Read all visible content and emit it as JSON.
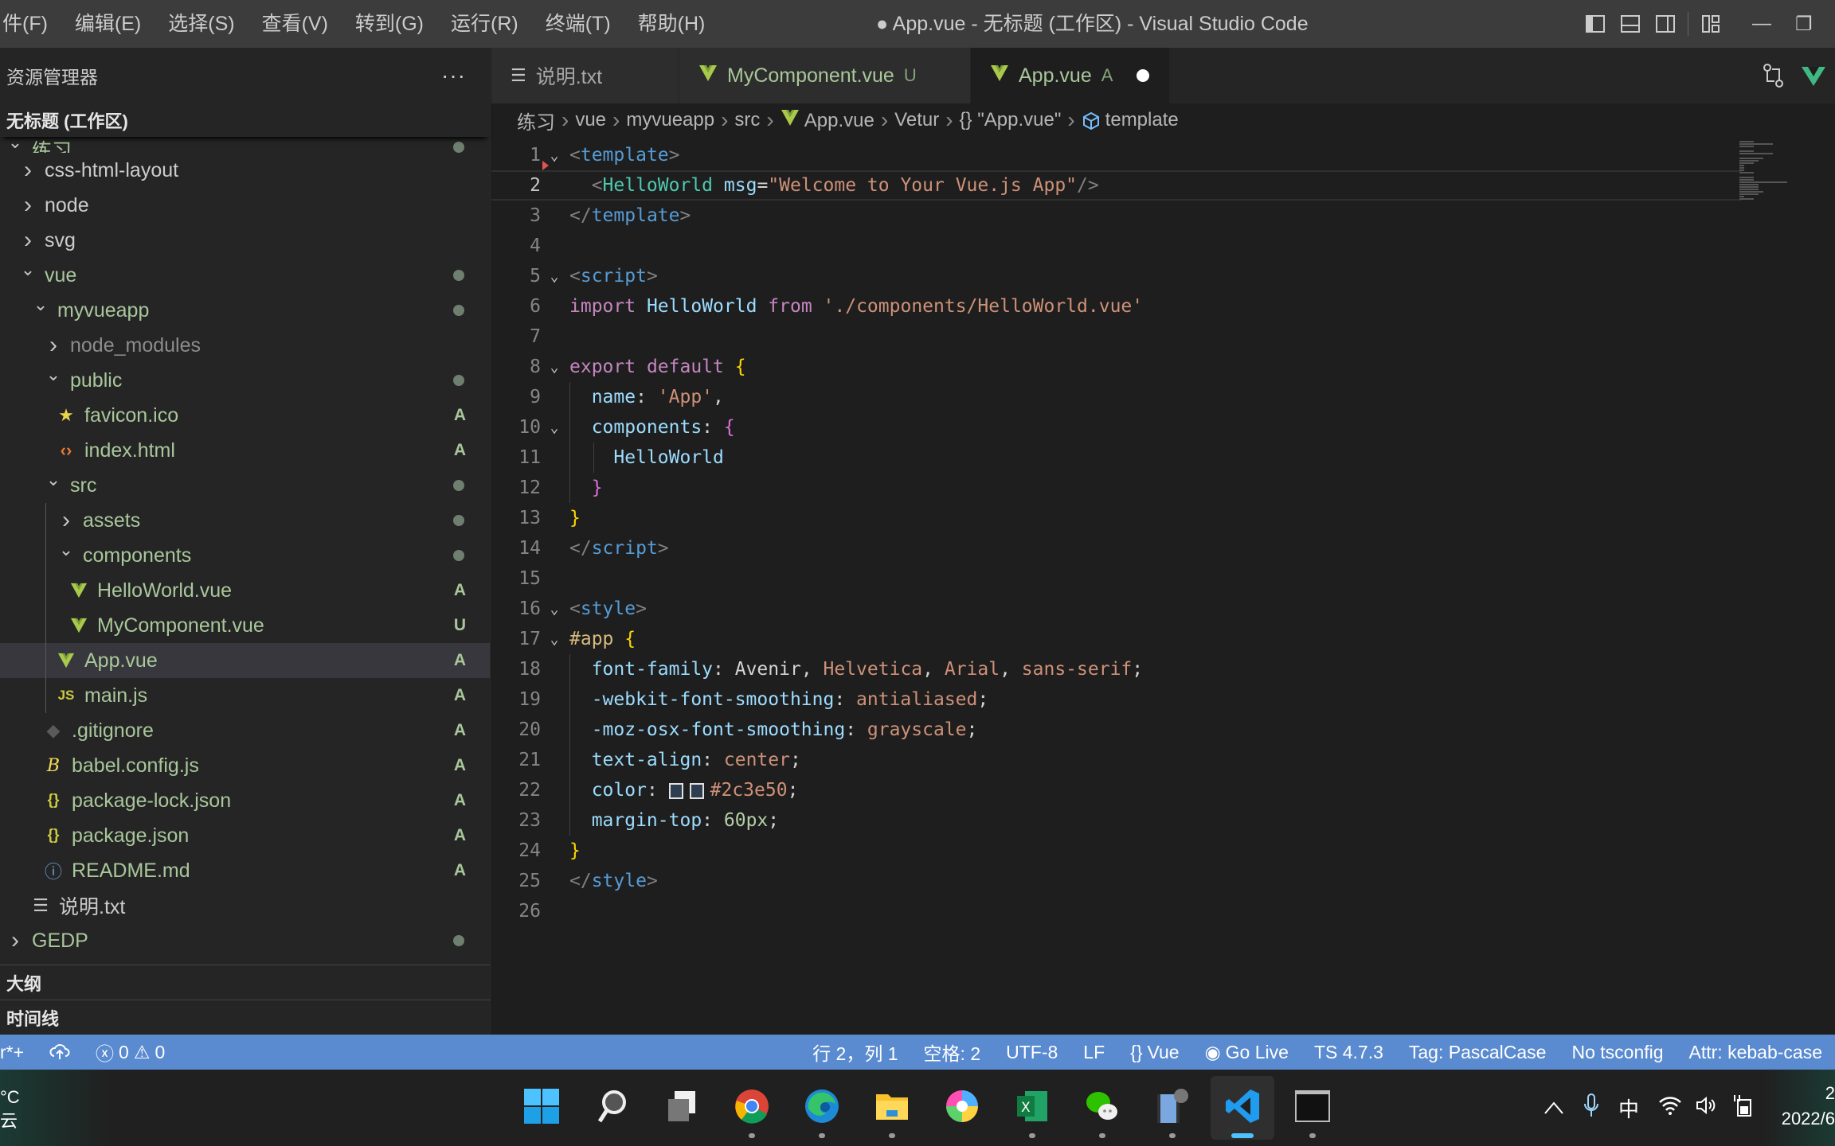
{
  "titlebar": {
    "menu": [
      "件(F)",
      "编辑(E)",
      "选择(S)",
      "查看(V)",
      "转到(G)",
      "运行(R)",
      "终端(T)",
      "帮助(H)"
    ],
    "window_title": "● App.vue - 无标题 (工作区) - Visual Studio Code",
    "minimize": "—",
    "maximize": "❐"
  },
  "sidebar": {
    "title": "资源管理器",
    "more": "···",
    "workspace": "无标题 (工作区)",
    "items": [
      {
        "label": "练习",
        "chevron": "down",
        "git": "mod",
        "status": "dot"
      },
      {
        "label": "css-html-layout",
        "chevron": "right",
        "git": "",
        "status": ""
      },
      {
        "label": "node",
        "chevron": "right",
        "git": "",
        "status": ""
      },
      {
        "label": "svg",
        "chevron": "right",
        "git": "",
        "status": ""
      },
      {
        "label": "vue",
        "chevron": "down",
        "git": "mod",
        "status": "dot"
      },
      {
        "label": "myvueapp",
        "chevron": "down",
        "git": "mod",
        "status": "dot"
      },
      {
        "label": "node_modules",
        "chevron": "right",
        "git": "ignored",
        "status": ""
      },
      {
        "label": "public",
        "chevron": "down",
        "git": "mod",
        "status": "dot"
      },
      {
        "label": "favicon.ico",
        "icon": "star",
        "git": "a",
        "status": "A"
      },
      {
        "label": "index.html",
        "icon": "html",
        "git": "a",
        "status": "A"
      },
      {
        "label": "src",
        "chevron": "down",
        "git": "mod",
        "status": "dot"
      },
      {
        "label": "assets",
        "chevron": "right",
        "git": "mod",
        "status": "dot"
      },
      {
        "label": "components",
        "chevron": "down",
        "git": "mod",
        "status": "dot"
      },
      {
        "label": "HelloWorld.vue",
        "icon": "vue",
        "git": "a",
        "status": "A"
      },
      {
        "label": "MyComponent.vue",
        "icon": "vue",
        "git": "u",
        "status": "U"
      },
      {
        "label": "App.vue",
        "icon": "vue",
        "git": "a",
        "status": "A",
        "selected": true
      },
      {
        "label": "main.js",
        "icon": "js",
        "git": "a",
        "status": "A"
      },
      {
        "label": ".gitignore",
        "icon": "git",
        "git": "a",
        "status": "A"
      },
      {
        "label": "babel.config.js",
        "icon": "babel",
        "git": "a",
        "status": "A"
      },
      {
        "label": "package-lock.json",
        "icon": "json",
        "git": "a",
        "status": "A"
      },
      {
        "label": "package.json",
        "icon": "json",
        "git": "a",
        "status": "A"
      },
      {
        "label": "README.md",
        "icon": "info",
        "git": "a",
        "status": "A"
      },
      {
        "label": "说明.txt",
        "icon": "text",
        "git": "",
        "status": ""
      },
      {
        "label": "GEDP",
        "chevron": "right",
        "git": "mod",
        "status": "dot"
      }
    ],
    "outline": "大纲",
    "timeline": "时间线"
  },
  "tabs": [
    {
      "label": "说明.txt",
      "icon": "text",
      "badge": "",
      "active": false
    },
    {
      "label": "MyComponent.vue",
      "icon": "vue",
      "badge": "U",
      "active": false
    },
    {
      "label": "App.vue",
      "icon": "vue",
      "badge": "A",
      "active": true,
      "dirty": true
    }
  ],
  "breadcrumb": [
    "练习",
    "vue",
    "myvueapp",
    "src",
    "App.vue",
    "Vetur",
    "{} \"App.vue\"",
    "template"
  ],
  "editor": {
    "current_line": 2,
    "lines": [
      [
        {
          "t": "<",
          "c": "c-punc"
        },
        {
          "t": "template",
          "c": "c-tag"
        },
        {
          "t": ">",
          "c": "c-punc"
        }
      ],
      [
        {
          "t": "  <",
          "c": "c-punc"
        },
        {
          "t": "HelloWorld",
          "c": "c-comp"
        },
        {
          "t": " ",
          "c": "c-plain"
        },
        {
          "t": "msg",
          "c": "c-attr"
        },
        {
          "t": "=",
          "c": "c-plain"
        },
        {
          "t": "\"Welcome to Your Vue.js App\"",
          "c": "c-str"
        },
        {
          "t": "/>",
          "c": "c-punc"
        }
      ],
      [
        {
          "t": "</",
          "c": "c-punc"
        },
        {
          "t": "template",
          "c": "c-tag"
        },
        {
          "t": ">",
          "c": "c-punc"
        }
      ],
      [],
      [
        {
          "t": "<",
          "c": "c-punc"
        },
        {
          "t": "script",
          "c": "c-tag"
        },
        {
          "t": ">",
          "c": "c-punc"
        }
      ],
      [
        {
          "t": "import",
          "c": "c-kw"
        },
        {
          "t": " ",
          "c": "c-plain"
        },
        {
          "t": "HelloWorld",
          "c": "c-id"
        },
        {
          "t": " ",
          "c": "c-plain"
        },
        {
          "t": "from",
          "c": "c-kw"
        },
        {
          "t": " ",
          "c": "c-plain"
        },
        {
          "t": "'./components/HelloWorld.vue'",
          "c": "c-str"
        }
      ],
      [],
      [
        {
          "t": "export",
          "c": "c-kw"
        },
        {
          "t": " ",
          "c": "c-plain"
        },
        {
          "t": "default",
          "c": "c-kw"
        },
        {
          "t": " ",
          "c": "c-plain"
        },
        {
          "t": "{",
          "c": "c-brace1"
        }
      ],
      [
        {
          "t": "  name",
          "c": "c-id"
        },
        {
          "t": ": ",
          "c": "c-plain"
        },
        {
          "t": "'App'",
          "c": "c-str"
        },
        {
          "t": ",",
          "c": "c-plain"
        }
      ],
      [
        {
          "t": "  components",
          "c": "c-id"
        },
        {
          "t": ": ",
          "c": "c-plain"
        },
        {
          "t": "{",
          "c": "c-brace2"
        }
      ],
      [
        {
          "t": "    HelloWorld",
          "c": "c-id"
        }
      ],
      [
        {
          "t": "  }",
          "c": "c-brace2"
        }
      ],
      [
        {
          "t": "}",
          "c": "c-brace1"
        }
      ],
      [
        {
          "t": "</",
          "c": "c-punc"
        },
        {
          "t": "script",
          "c": "c-tag"
        },
        {
          "t": ">",
          "c": "c-punc"
        }
      ],
      [],
      [
        {
          "t": "<",
          "c": "c-punc"
        },
        {
          "t": "style",
          "c": "c-tag"
        },
        {
          "t": ">",
          "c": "c-punc"
        }
      ],
      [
        {
          "t": "#app",
          "c": "c-sel"
        },
        {
          "t": " ",
          "c": "c-plain"
        },
        {
          "t": "{",
          "c": "c-brace1"
        }
      ],
      [
        {
          "t": "  font-family",
          "c": "c-prop"
        },
        {
          "t": ": ",
          "c": "c-plain"
        },
        {
          "t": "Avenir",
          "c": "c-plain"
        },
        {
          "t": ", ",
          "c": "c-plain"
        },
        {
          "t": "Helvetica",
          "c": "c-str"
        },
        {
          "t": ", ",
          "c": "c-plain"
        },
        {
          "t": "Arial",
          "c": "c-str"
        },
        {
          "t": ", ",
          "c": "c-plain"
        },
        {
          "t": "sans-serif",
          "c": "c-str"
        },
        {
          "t": ";",
          "c": "c-plain"
        }
      ],
      [
        {
          "t": "  -webkit-font-smoothing",
          "c": "c-prop"
        },
        {
          "t": ": ",
          "c": "c-plain"
        },
        {
          "t": "antialiased",
          "c": "c-str"
        },
        {
          "t": ";",
          "c": "c-plain"
        }
      ],
      [
        {
          "t": "  -moz-osx-font-smoothing",
          "c": "c-prop"
        },
        {
          "t": ": ",
          "c": "c-plain"
        },
        {
          "t": "grayscale",
          "c": "c-str"
        },
        {
          "t": ";",
          "c": "c-plain"
        }
      ],
      [
        {
          "t": "  text-align",
          "c": "c-prop"
        },
        {
          "t": ": ",
          "c": "c-plain"
        },
        {
          "t": "center",
          "c": "c-str"
        },
        {
          "t": ";",
          "c": "c-plain"
        }
      ],
      [
        {
          "t": "  color",
          "c": "c-prop"
        },
        {
          "t": ": ",
          "c": "c-plain"
        },
        {
          "t": "SWATCH",
          "c": "swatch2"
        },
        {
          "t": "#2c3e50",
          "c": "c-str"
        },
        {
          "t": ";",
          "c": "c-plain"
        }
      ],
      [
        {
          "t": "  margin-top",
          "c": "c-prop"
        },
        {
          "t": ": ",
          "c": "c-plain"
        },
        {
          "t": "60px",
          "c": "c-num"
        },
        {
          "t": ";",
          "c": "c-plain"
        }
      ],
      [
        {
          "t": "}",
          "c": "c-brace1"
        }
      ],
      [
        {
          "t": "</",
          "c": "c-punc"
        },
        {
          "t": "style",
          "c": "c-tag"
        },
        {
          "t": ">",
          "c": "c-punc"
        }
      ],
      []
    ],
    "folds": [
      1,
      5,
      8,
      10,
      16,
      17
    ],
    "swatch_color": "#2c3e50"
  },
  "statusbar": {
    "left": {
      "branch": "r*+",
      "sync_icon": "cloud-sync",
      "errors": "0",
      "warnings": "0"
    },
    "right": [
      "行 2，列 1",
      "空格: 2",
      "UTF-8",
      "LF",
      "Vue",
      "Go Live",
      "TS 4.7.3",
      "Tag: PascalCase",
      "No tsconfig",
      "Attr: kebab-case"
    ]
  },
  "taskbar": {
    "weather_temp": "°C",
    "weather_desc": "云",
    "apps": [
      "start",
      "search",
      "task-view",
      "chrome",
      "edge",
      "file-explorer",
      "photos",
      "excel",
      "wechat",
      "video-player",
      "vscode",
      "terminal"
    ],
    "active_app": "vscode",
    "tray": [
      "^",
      "🎤",
      "中",
      "wifi",
      "volume",
      "battery"
    ],
    "clock_time": "2",
    "clock_date": "2022/6"
  },
  "colors": {
    "statusbar": "#5a8bd0",
    "accent_vue": "#a9c94a",
    "git_added": "#a9c79a"
  }
}
